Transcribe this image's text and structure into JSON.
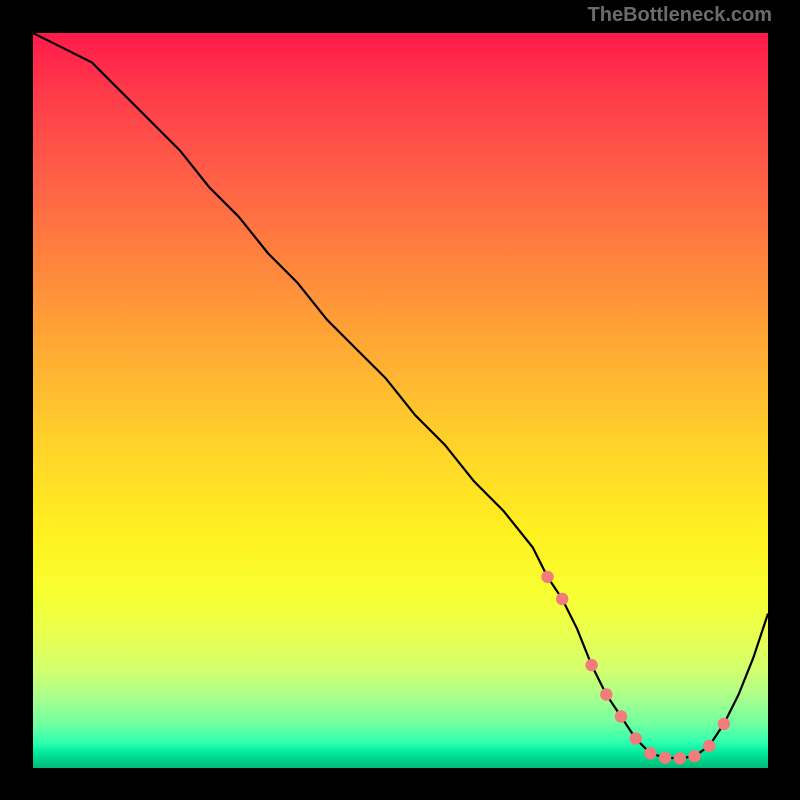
{
  "watermark": "TheBottleneck.com",
  "colors": {
    "curve": "#000000",
    "marker": "#f27b7b",
    "bg_top": "#ff1a4a",
    "bg_bottom": "#00b878"
  },
  "chart_data": {
    "type": "line",
    "title": "",
    "xlabel": "",
    "ylabel": "",
    "xlim": [
      0,
      100
    ],
    "ylim": [
      0,
      100
    ],
    "series": [
      {
        "name": "curve",
        "x": [
          0,
          4,
          8,
          12,
          16,
          20,
          24,
          28,
          32,
          36,
          40,
          44,
          48,
          52,
          56,
          60,
          64,
          68,
          70,
          72,
          74,
          76,
          78,
          80,
          82,
          84,
          86,
          88,
          90,
          92,
          94,
          96,
          98,
          100
        ],
        "y": [
          100,
          98,
          96,
          92,
          88,
          84,
          79,
          75,
          70,
          66,
          61,
          57,
          53,
          48,
          44,
          39,
          35,
          30,
          26,
          23,
          19,
          14,
          10,
          7,
          4,
          2,
          1.4,
          1.3,
          1.6,
          3,
          6,
          10,
          15,
          21
        ]
      }
    ],
    "markers": {
      "name": "optimal-range",
      "shape": "circle",
      "color": "#f27b7b",
      "x": [
        70,
        72,
        76,
        78,
        80,
        82,
        84,
        86,
        88,
        90,
        92,
        94
      ],
      "y": [
        26,
        23,
        14,
        10,
        7,
        4,
        2,
        1.4,
        1.3,
        1.6,
        3,
        6
      ]
    }
  }
}
